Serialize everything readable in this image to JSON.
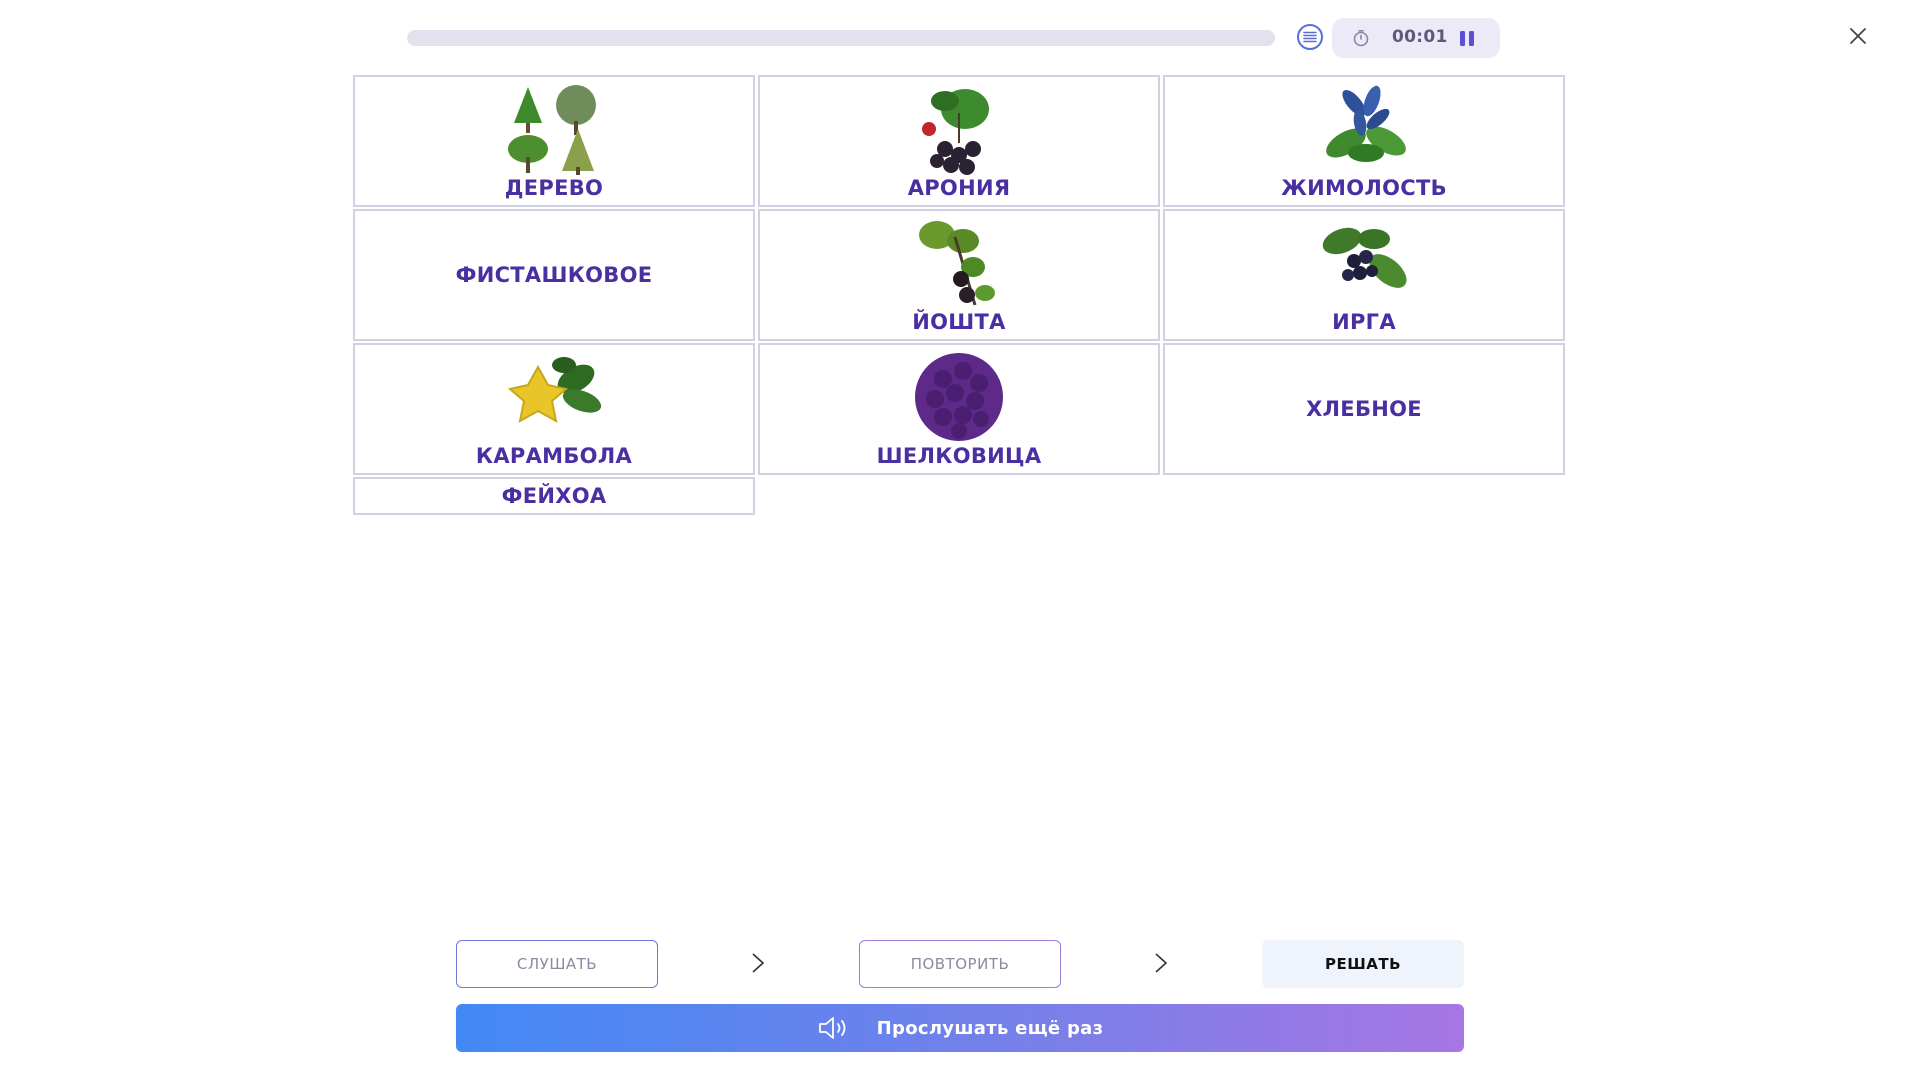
{
  "header": {
    "progress_percent": 0,
    "timer": "00:01"
  },
  "cards": [
    {
      "label": "ДЕРЕВО",
      "image": "trees"
    },
    {
      "label": "АРОНИЯ",
      "image": "aronia-berries"
    },
    {
      "label": "ЖИМОЛОСТЬ",
      "image": "honeysuckle"
    },
    {
      "label": "ФИСТАШКОВОЕ",
      "image": ""
    },
    {
      "label": "ЙОШТА",
      "image": "jostaberry"
    },
    {
      "label": "ИРГА",
      "image": "serviceberry"
    },
    {
      "label": "КАРАМБОЛА",
      "image": "carambola"
    },
    {
      "label": "ШЕЛКОВИЦА",
      "image": "mulberry"
    },
    {
      "label": "ХЛЕБНОЕ",
      "image": ""
    },
    {
      "label": "ФЕЙХОА",
      "image": ""
    }
  ],
  "steps": {
    "listen": "СЛУШАТЬ",
    "repeat": "ПОВТОРИТЬ",
    "solve": "РЕШАТЬ"
  },
  "replay_label": "Прослушать ещё раз",
  "colors": {
    "accent": "#4a2fa3",
    "gradient_start": "#4289f5",
    "gradient_end": "#a676e4"
  }
}
